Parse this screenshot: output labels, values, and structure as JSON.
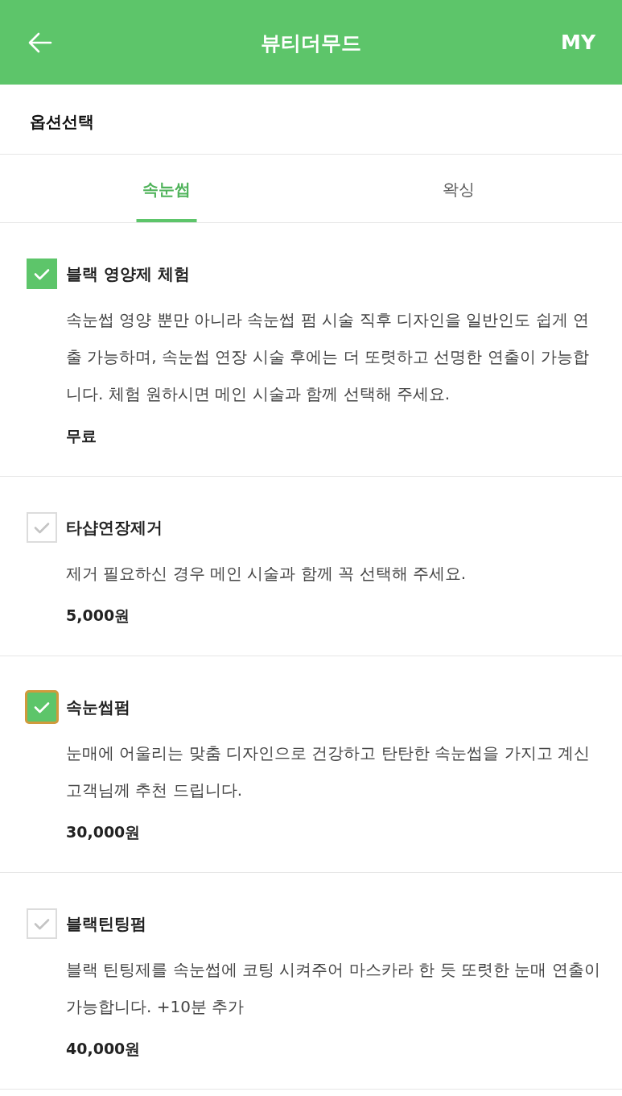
{
  "header": {
    "title": "뷰티더무드",
    "right_action": "MY"
  },
  "section_title": "옵션선택",
  "tabs": [
    {
      "label": "속눈썹",
      "selected": true
    },
    {
      "label": "왁싱",
      "selected": false
    }
  ],
  "options": [
    {
      "name": "블랙 영양제 체험",
      "checked": true,
      "focused": false,
      "description": "속눈썹 영양 뿐만 아니라 속눈썹 펌 시술 직후 디자인을 일반인도 쉽게 연출 가능하며, 속눈썹 연장 시술 후에는 더 또렷하고 선명한 연출이 가능합니다. 체험 원하시면 메인 시술과 함께 선택해 주세요.",
      "price": "무료"
    },
    {
      "name": "타샵연장제거",
      "checked": false,
      "focused": false,
      "description": "제거 필요하신 경우 메인 시술과 함께 꼭 선택해 주세요.",
      "price": "5,000원"
    },
    {
      "name": "속눈썹펌",
      "checked": true,
      "focused": true,
      "description": "눈매에 어울리는 맞춤 디자인으로 건강하고 탄탄한 속눈썹을 가지고 계신 고객님께 추천 드립니다.",
      "price": "30,000원"
    },
    {
      "name": "블랙틴팅펌",
      "checked": false,
      "focused": false,
      "description": "블랙 틴팅제를 속눈썹에 코팅 시켜주어 마스카라 한 듯 또렷한 눈매 연출이 가능합니다. +10분 추가",
      "price": "40,000원"
    }
  ]
}
